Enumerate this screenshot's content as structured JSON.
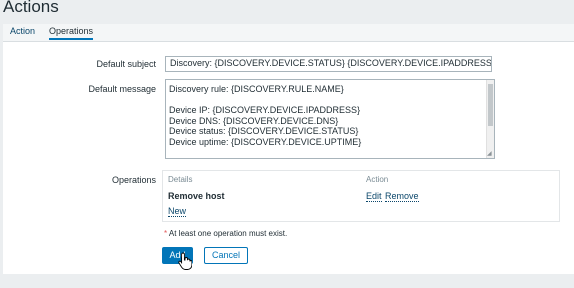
{
  "page": {
    "title": "Actions"
  },
  "tabs": [
    {
      "label": "Action",
      "active": false
    },
    {
      "label": "Operations",
      "active": true
    }
  ],
  "form": {
    "default_subject": {
      "label": "Default subject",
      "value": "Discovery: {DISCOVERY.DEVICE.STATUS} {DISCOVERY.DEVICE.IPADDRESS}"
    },
    "default_message": {
      "label": "Default message",
      "value": "Discovery rule: {DISCOVERY.RULE.NAME}\n\nDevice IP: {DISCOVERY.DEVICE.IPADDRESS}\nDevice DNS: {DISCOVERY.DEVICE.DNS}\nDevice status: {DISCOVERY.DEVICE.STATUS}\nDevice uptime: {DISCOVERY.DEVICE.UPTIME}"
    },
    "operations": {
      "label": "Operations",
      "columns": {
        "details": "Details",
        "action": "Action"
      },
      "rows": [
        {
          "details": "Remove host",
          "edit_label": "Edit",
          "remove_label": "Remove"
        }
      ],
      "new_label": "New"
    },
    "note": {
      "star": "*",
      "text": "At least one operation must exist."
    }
  },
  "buttons": {
    "add": "Add",
    "cancel": "Cancel"
  },
  "colors": {
    "primary": "#0275b8",
    "link": "#0a466a",
    "background": "#ebeef0"
  }
}
